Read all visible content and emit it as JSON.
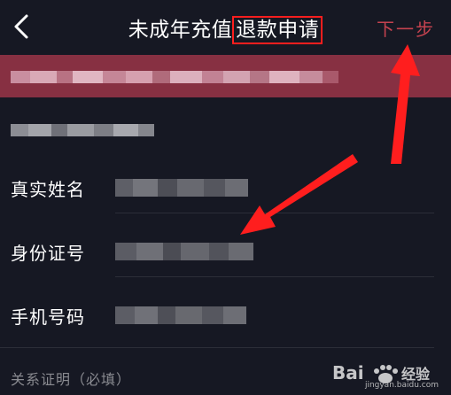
{
  "header": {
    "title_prefix": "未成年充值",
    "title_highlight": "退款申请",
    "next_label": "下一步"
  },
  "form": {
    "real_name_label": "真实姓名",
    "id_number_label": "身份证号",
    "phone_label": "手机号码",
    "relation_proof_label": "关系证明（必填）"
  },
  "watermark": {
    "brand": "Bai",
    "jingyan": "经验",
    "url": "jingyan.baidu.com"
  },
  "colors": {
    "background": "#161823",
    "banner": "#873042",
    "next": "#c4424f",
    "annotation": "#ff1e1e"
  }
}
